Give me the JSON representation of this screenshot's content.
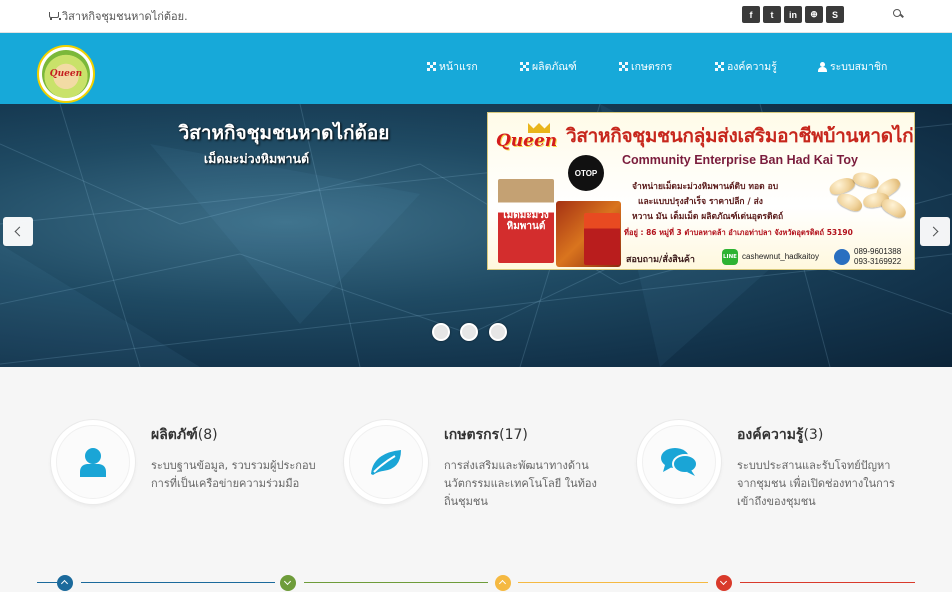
{
  "topbar": {
    "shop_name": "วิสาหกิจชุมชนหาดไก่ต้อย.",
    "socials": [
      {
        "icon": "facebook-icon",
        "glyph": "f"
      },
      {
        "icon": "twitter-icon",
        "glyph": "t"
      },
      {
        "icon": "linkedin-icon",
        "glyph": "in"
      },
      {
        "icon": "dribbble-icon",
        "glyph": "⊕"
      },
      {
        "icon": "skype-icon",
        "glyph": "S"
      }
    ]
  },
  "nav": {
    "items": [
      {
        "label": "หน้าแรก",
        "icon": "grid-icon"
      },
      {
        "label": "ผลิตภัณฑ์",
        "icon": "grid-icon"
      },
      {
        "label": "เกษตรกร",
        "icon": "grid-icon"
      },
      {
        "label": "องค์ความรู้",
        "icon": "grid-icon"
      },
      {
        "label": "ระบบสมาชิก",
        "icon": "user-icon"
      }
    ],
    "logo_text": "Queen"
  },
  "hero": {
    "title": "วิสาหกิจชุมชนหาดไก่ต้อย",
    "subtitle": "เม็ดมะม่วงหิมพานต์",
    "slides_count": 3,
    "banner": {
      "brand": "Queen",
      "title_th": "วิสาหกิจชุมชนกลุ่มส่งเสริมอาชีพบ้านหาดไก่ต้อย",
      "title_en": "Community Enterprise Ban Had Kai Toy",
      "otop": "OTOP",
      "line1": "จำหน่ายเม็ดมะม่วงหิมพานต์ดิบ ทอด อบ",
      "line2": "และแบบปรุงสำเร็จ ราคาปลีก / ส่ง",
      "line3": "หวาน มัน เต็มเม็ด ผลิตภัณฑ์เด่นอุตรดิตถ์",
      "address": "ที่อยู่ : 86 หมู่ที่ 3 ตำบลหาดล้า อำเภอท่าปลา จังหวัดอุตรดิตถ์ 53190",
      "product_label": "เม็ดมะม่วง หิมพานต์",
      "ask": "สอบถาม/สั่งสินค้า",
      "line_label": "LINE",
      "line_id": "cashewnut_hadkaitoy",
      "phone1": "089-9601388",
      "phone2": "093-3169922"
    }
  },
  "features": [
    {
      "title": "ผลิตภัฑ์",
      "count": "(8)",
      "desc": "ระบบฐานข้อมูล, รวบรวมผู้ประกอบการที่เป็นเครือข่ายความร่วมมือ",
      "icon": "user-icon",
      "color": "#1aa5d6"
    },
    {
      "title": "เกษตรกร",
      "count": "(17)",
      "desc": "การส่งเสริมและพัฒนาทางด้านนวัตกรรมและเทคโนโลยี ในท้องถิ่นชุมชน",
      "icon": "leaf-icon",
      "color": "#1aa5d6"
    },
    {
      "title": "องค์ความรู้",
      "count": "(3)",
      "desc": "ระบบประสานและรับโจทย์ปัญหาจากชุมชน เพื่อเปิดช่องทางในการเข้าถึงของชุมชน",
      "icon": "comments-icon",
      "color": "#1aa5d6"
    }
  ],
  "divider": {
    "colors": [
      "#1b6a9c",
      "#6e9c3a",
      "#f5b942",
      "#d93a2b"
    ],
    "arrows": [
      "up",
      "down",
      "up",
      "down"
    ]
  }
}
